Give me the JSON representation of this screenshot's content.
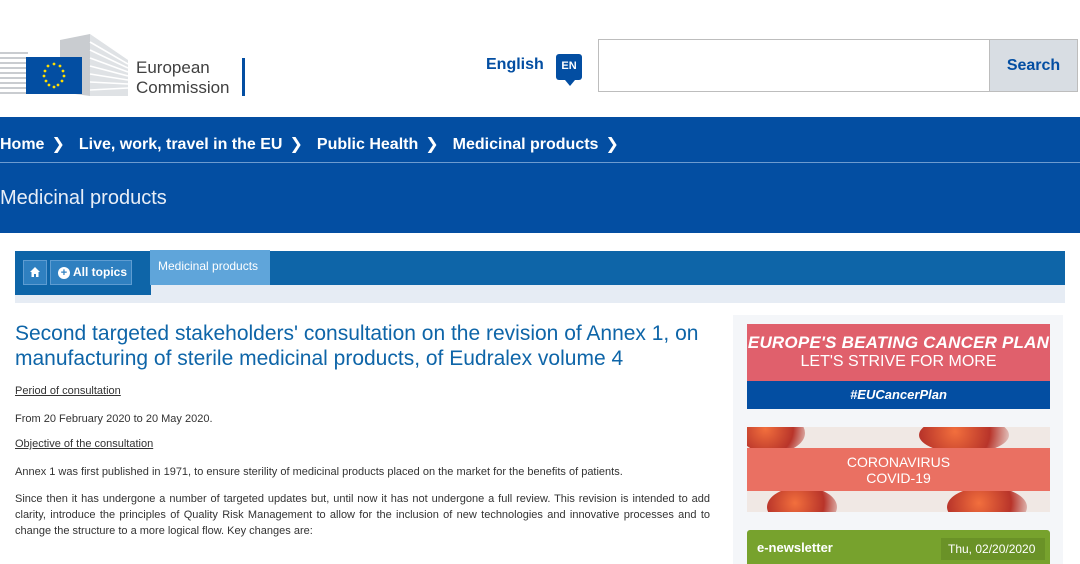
{
  "header": {
    "logo_line1": "European",
    "logo_line2": "Commission",
    "language": "English",
    "language_code": "EN",
    "search_placeholder": "",
    "search_button": "Search"
  },
  "breadcrumb": [
    {
      "label": "Home"
    },
    {
      "label": "Live, work, travel in the EU"
    },
    {
      "label": "Public Health"
    },
    {
      "label": "Medicinal products"
    }
  ],
  "page_title": "Medicinal products",
  "topic_nav": {
    "all_topics": "All topics",
    "active_tab": "Medicinal products"
  },
  "article": {
    "title": "Second targeted stakeholders' consultation on the revision of Annex 1, on manufacturing of sterile medicinal products, of Eudralex volume 4",
    "period_heading": "Period of consultation",
    "period_text": "From 20 February 2020 to 20 May 2020.",
    "objective_heading": "Objective of the consultation",
    "para1": "Annex 1 was first published in 1971, to ensure sterility of medicinal products placed on the market for the benefits of patients.",
    "para2": "Since then it has undergone a number of targeted updates but, until now it has not undergone a full review. This revision is intended to add clarity, introduce the principles of Quality Risk Management to allow for the inclusion of new technologies and innovative processes and to change the structure to a more logical flow. Key changes are:"
  },
  "sidebar": {
    "cancer_title": "EUROPE'S BEATING CANCER PLAN",
    "cancer_sub": "LET'S STRIVE FOR MORE",
    "cancer_tag": "#EUCancerPlan",
    "covid_line1": "CORONAVIRUS",
    "covid_line2": "COVID-19",
    "newsletter_label": "e-newsletter",
    "newsletter_date": "Thu, 02/20/2020"
  },
  "colors": {
    "ec_blue": "#034ea2",
    "topic_blue": "#0e65a8",
    "cancer_red": "#e0606c",
    "newsletter_green": "#77a22d"
  }
}
